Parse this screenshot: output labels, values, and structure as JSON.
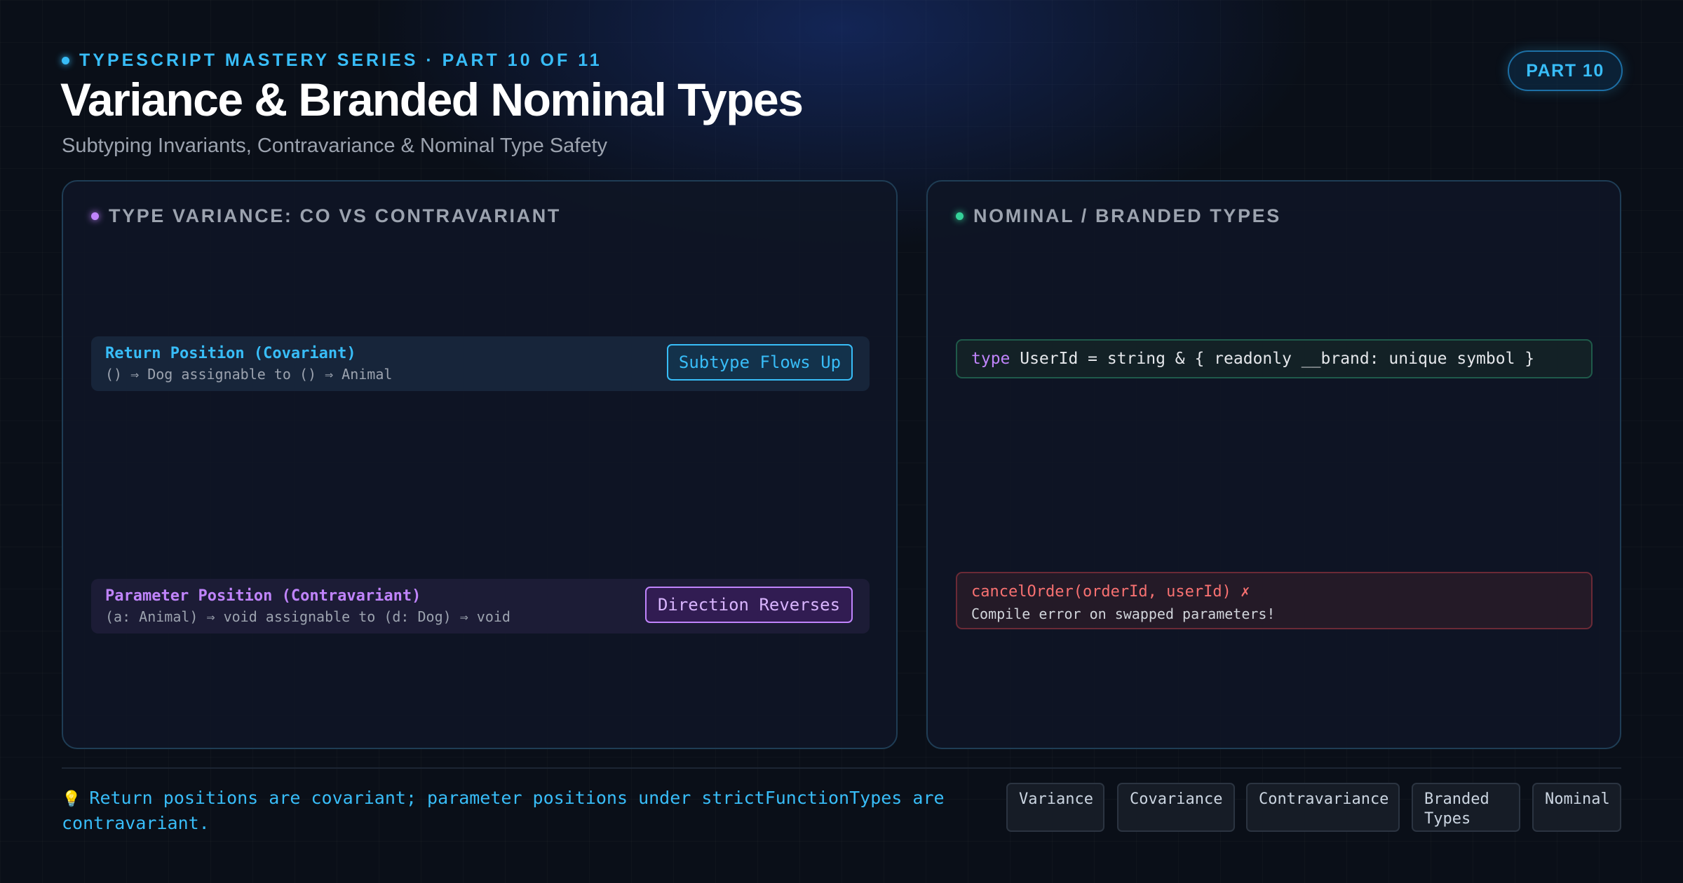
{
  "header": {
    "series": "TYPESCRIPT MASTERY SERIES · PART 10 OF 11",
    "title": "Variance & Branded Nominal Types",
    "subtitle": "Subtyping Invariants, Contravariance & Nominal Type Safety",
    "badge": "PART 10"
  },
  "variance_panel": {
    "title": "TYPE VARIANCE: CO VS CONTRAVARIANT",
    "covariant": {
      "heading": "Return Position (Covariant)",
      "description": "() ⇒ Dog assignable to () ⇒ Animal",
      "pill": "Subtype Flows Up"
    },
    "contravariant": {
      "heading": "Parameter Position (Contravariant)",
      "description": "(a: Animal) ⇒ void assignable to (d: Dog) ⇒ void",
      "pill": "Direction Reverses"
    }
  },
  "nominal_panel": {
    "title": "NOMINAL / BRANDED TYPES",
    "code_keyword": "type",
    "code_rest": " UserId = string & { readonly __brand: unique symbol }",
    "error_line": "cancelOrder(orderId, userId) ✗",
    "error_sub": "Compile error on swapped parameters!"
  },
  "footer": {
    "tip_icon": "💡",
    "tip": "Return positions are covariant; parameter positions under strictFunctionTypes are contravariant.",
    "tags": [
      "Variance",
      "Covariance",
      "Contravariance",
      "Branded Types",
      "Nominal"
    ]
  },
  "colors": {
    "accent_cyan": "#38bdf8",
    "accent_purple": "#c084fc",
    "accent_green": "#34d399",
    "error_red": "#f87171"
  }
}
